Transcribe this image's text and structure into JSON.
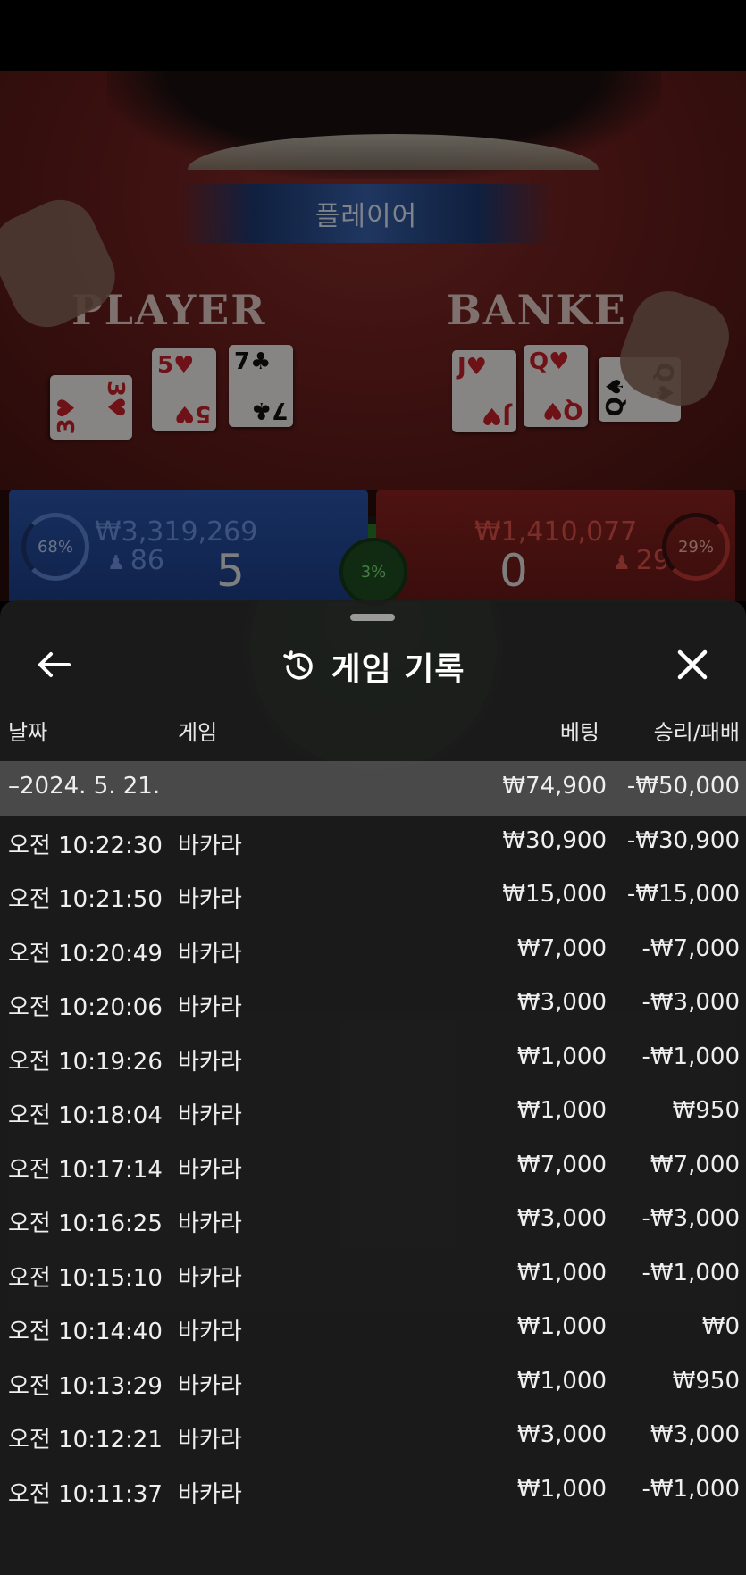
{
  "table": {
    "result_banner": "플레이어",
    "player_label": "PLAYER",
    "banker_label": "BANKE",
    "player_cards": [
      {
        "rank": "3",
        "suit": "♥",
        "color": "red"
      },
      {
        "rank": "5",
        "suit": "♥",
        "color": "red"
      },
      {
        "rank": "7",
        "suit": "♣",
        "color": "black"
      }
    ],
    "banker_cards": [
      {
        "rank": "J",
        "suit": "♥",
        "color": "red"
      },
      {
        "rank": "Q",
        "suit": "♥",
        "color": "red"
      },
      {
        "rank": "Q",
        "suit": "♠",
        "color": "black"
      }
    ]
  },
  "scoreboard": {
    "player_percent": "68%",
    "player_amount": "₩3,319,269",
    "player_count": "86",
    "player_score": "5",
    "tie_percent": "3%",
    "banker_amount": "₩1,410,077",
    "banker_count": "29",
    "banker_score": "0",
    "banker_percent": "29%"
  },
  "history": {
    "title": "게임 기록",
    "columns": {
      "date": "날짜",
      "game": "게임",
      "bet": "베팅",
      "result": "승리/패배"
    },
    "date_group": {
      "date": "–2024. 5. 21.",
      "bet": "₩74,900",
      "result": "-₩50,000"
    },
    "rows": [
      {
        "time": "오전 10:22:30",
        "game": "바카라",
        "bet": "₩30,900",
        "result": "-₩30,900"
      },
      {
        "time": "오전 10:21:50",
        "game": "바카라",
        "bet": "₩15,000",
        "result": "-₩15,000"
      },
      {
        "time": "오전 10:20:49",
        "game": "바카라",
        "bet": "₩7,000",
        "result": "-₩7,000"
      },
      {
        "time": "오전 10:20:06",
        "game": "바카라",
        "bet": "₩3,000",
        "result": "-₩3,000"
      },
      {
        "time": "오전 10:19:26",
        "game": "바카라",
        "bet": "₩1,000",
        "result": "-₩1,000"
      },
      {
        "time": "오전 10:18:04",
        "game": "바카라",
        "bet": "₩1,000",
        "result": "₩950"
      },
      {
        "time": "오전 10:17:14",
        "game": "바카라",
        "bet": "₩7,000",
        "result": "₩7,000"
      },
      {
        "time": "오전 10:16:25",
        "game": "바카라",
        "bet": "₩3,000",
        "result": "-₩3,000"
      },
      {
        "time": "오전 10:15:10",
        "game": "바카라",
        "bet": "₩1,000",
        "result": "-₩1,000"
      },
      {
        "time": "오전 10:14:40",
        "game": "바카라",
        "bet": "₩1,000",
        "result": "₩0"
      },
      {
        "time": "오전 10:13:29",
        "game": "바카라",
        "bet": "₩1,000",
        "result": "₩950"
      },
      {
        "time": "오전 10:12:21",
        "game": "바카라",
        "bet": "₩3,000",
        "result": "₩3,000"
      },
      {
        "time": "오전 10:11:37",
        "game": "바카라",
        "bet": "₩1,000",
        "result": "-₩1,000"
      }
    ]
  },
  "icons": {
    "back": "arrow-left-icon",
    "history": "history-clock-icon",
    "close": "close-icon"
  },
  "colors": {
    "player_blue": "#2b56ad",
    "banker_red": "#8e2321",
    "tie_green": "#2f8a30",
    "sheet_bg": "#1c1c1c",
    "date_row_bg": "#5a5a5a"
  }
}
